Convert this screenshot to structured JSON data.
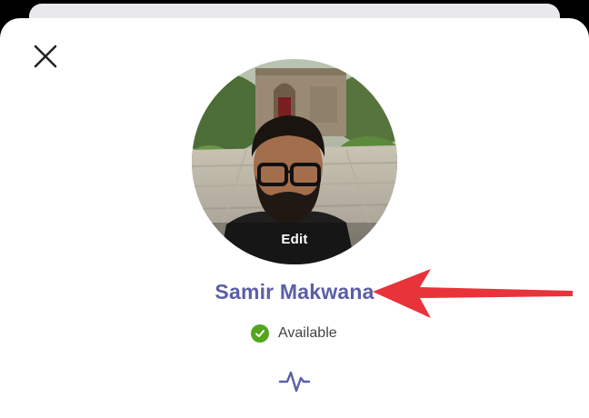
{
  "profile": {
    "name": "Samir Makwana",
    "edit_label": "Edit",
    "status": "Available",
    "status_color": "#55a51f"
  },
  "icons": {
    "close": "close-icon",
    "status": "checkmark-icon",
    "activity": "activity-pulse-icon"
  },
  "colors": {
    "name_color": "#5b5fa5",
    "annotation_arrow": "#e8333b",
    "sheet_background": "#ffffff"
  }
}
